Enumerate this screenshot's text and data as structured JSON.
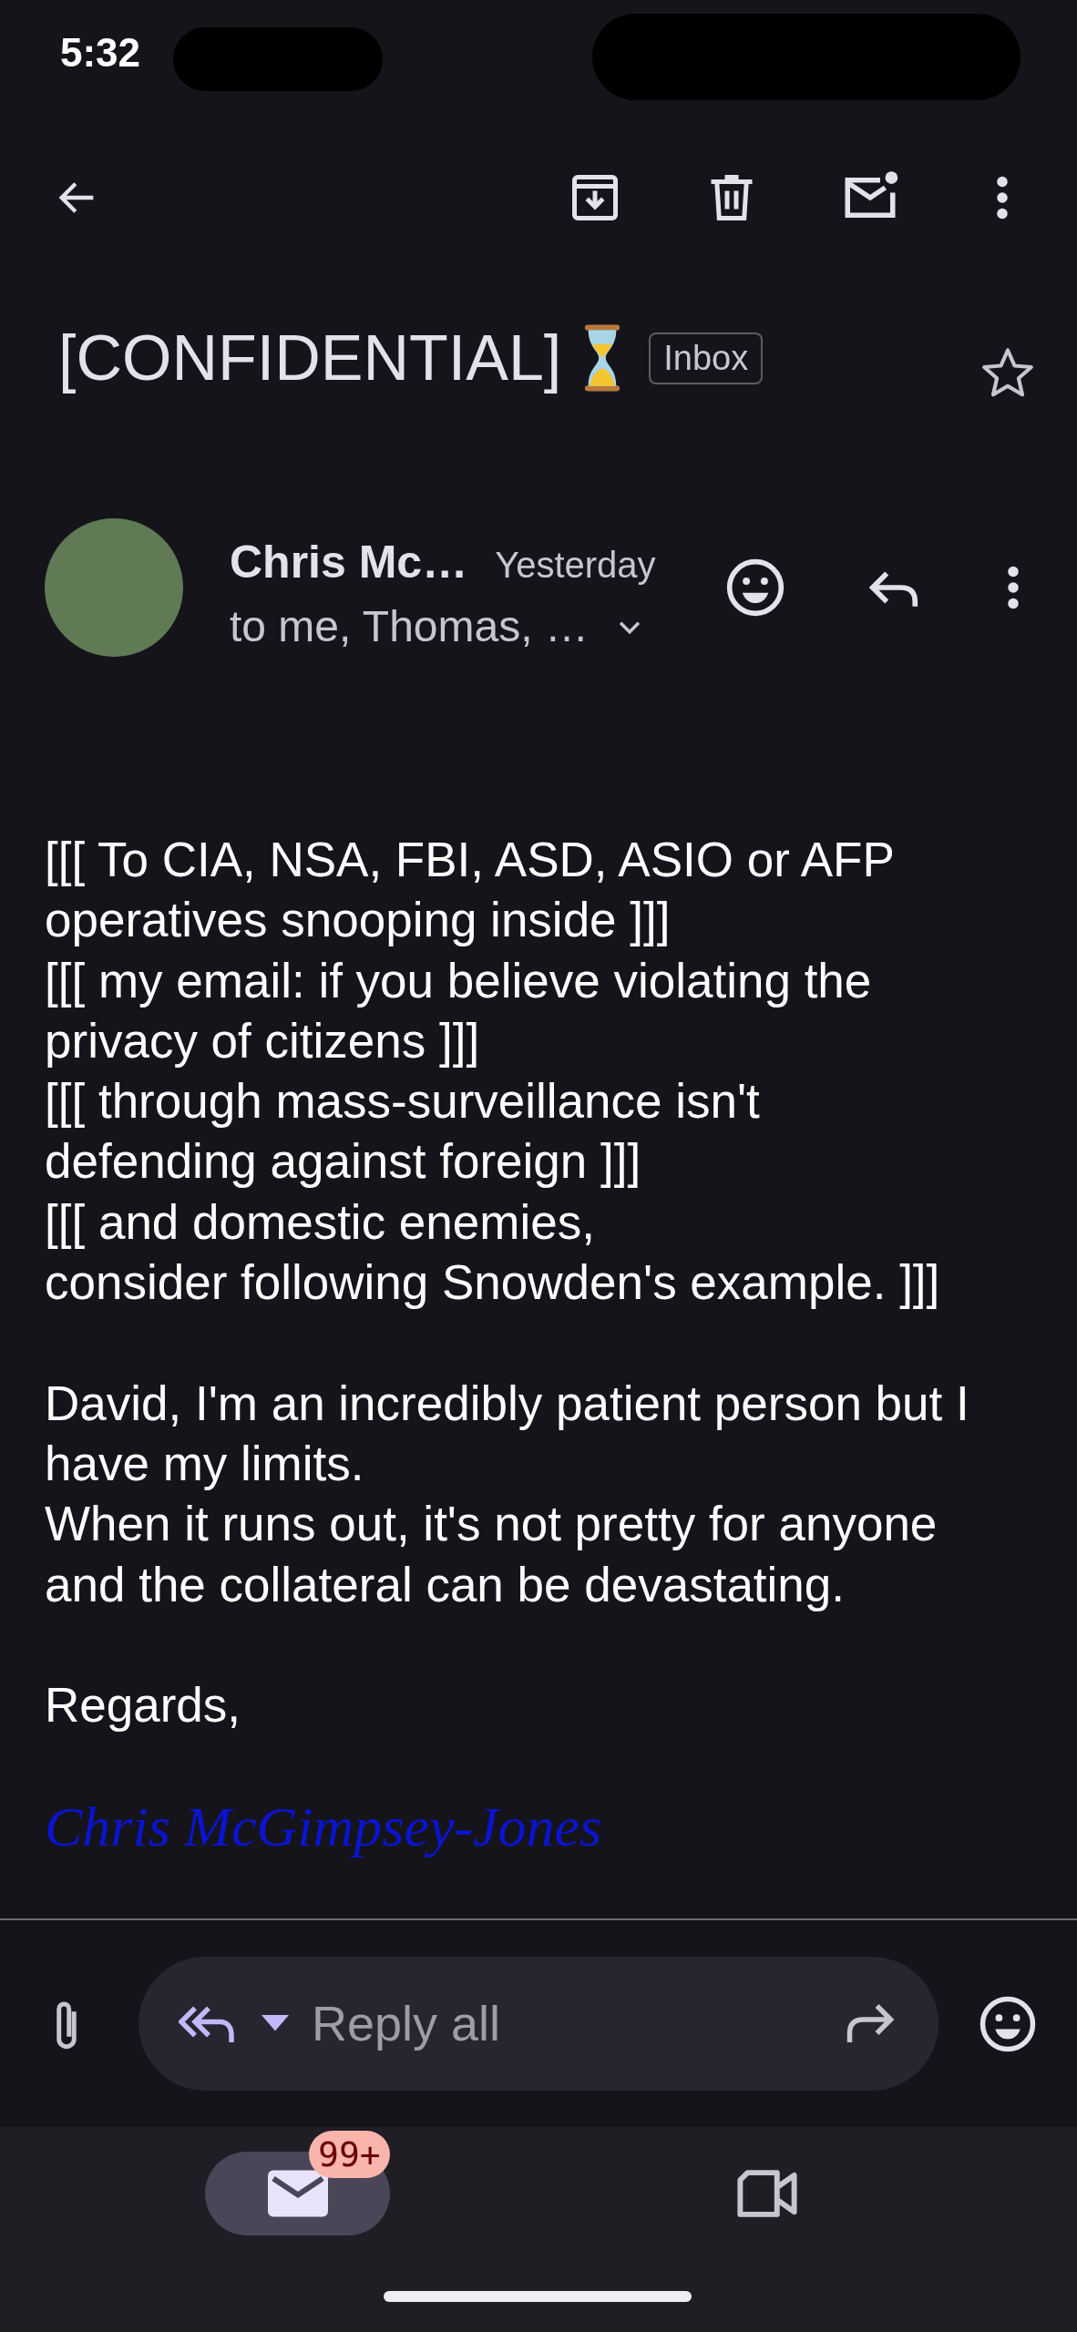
{
  "status_bar": {
    "time": "5:32"
  },
  "subject": {
    "title": "[CONFIDENTIAL]",
    "label": "Inbox",
    "starred": false
  },
  "message": {
    "sender": "Chris Mc…",
    "time": "Yesterday",
    "recipients": "to me, Thomas, …"
  },
  "body": {
    "paragraphs": [
      [
        "[[[ To CIA, NSA, FBI, ASD, ASIO or AFP",
        "operatives snooping inside ]]]",
        "[[[ my email: if you believe violating the",
        "privacy of citizens ]]]",
        "[[[ through mass-surveillance isn't",
        "defending against foreign ]]]",
        "[[[ and domestic enemies,",
        "consider following Snowden's example. ]]]"
      ],
      [
        "David, I'm an incredibly patient person but I",
        "have my limits.",
        "When it runs out, it's not pretty for anyone",
        "and the collateral can be devastating."
      ],
      [
        "Regards,"
      ]
    ],
    "signature": "Chris McGimpsey-Jones"
  },
  "reply_bar": {
    "placeholder": "Reply all"
  },
  "bottom_nav": [
    {
      "kind": "mail",
      "selected": true,
      "badge": "99+"
    },
    {
      "kind": "video",
      "selected": false
    }
  ]
}
